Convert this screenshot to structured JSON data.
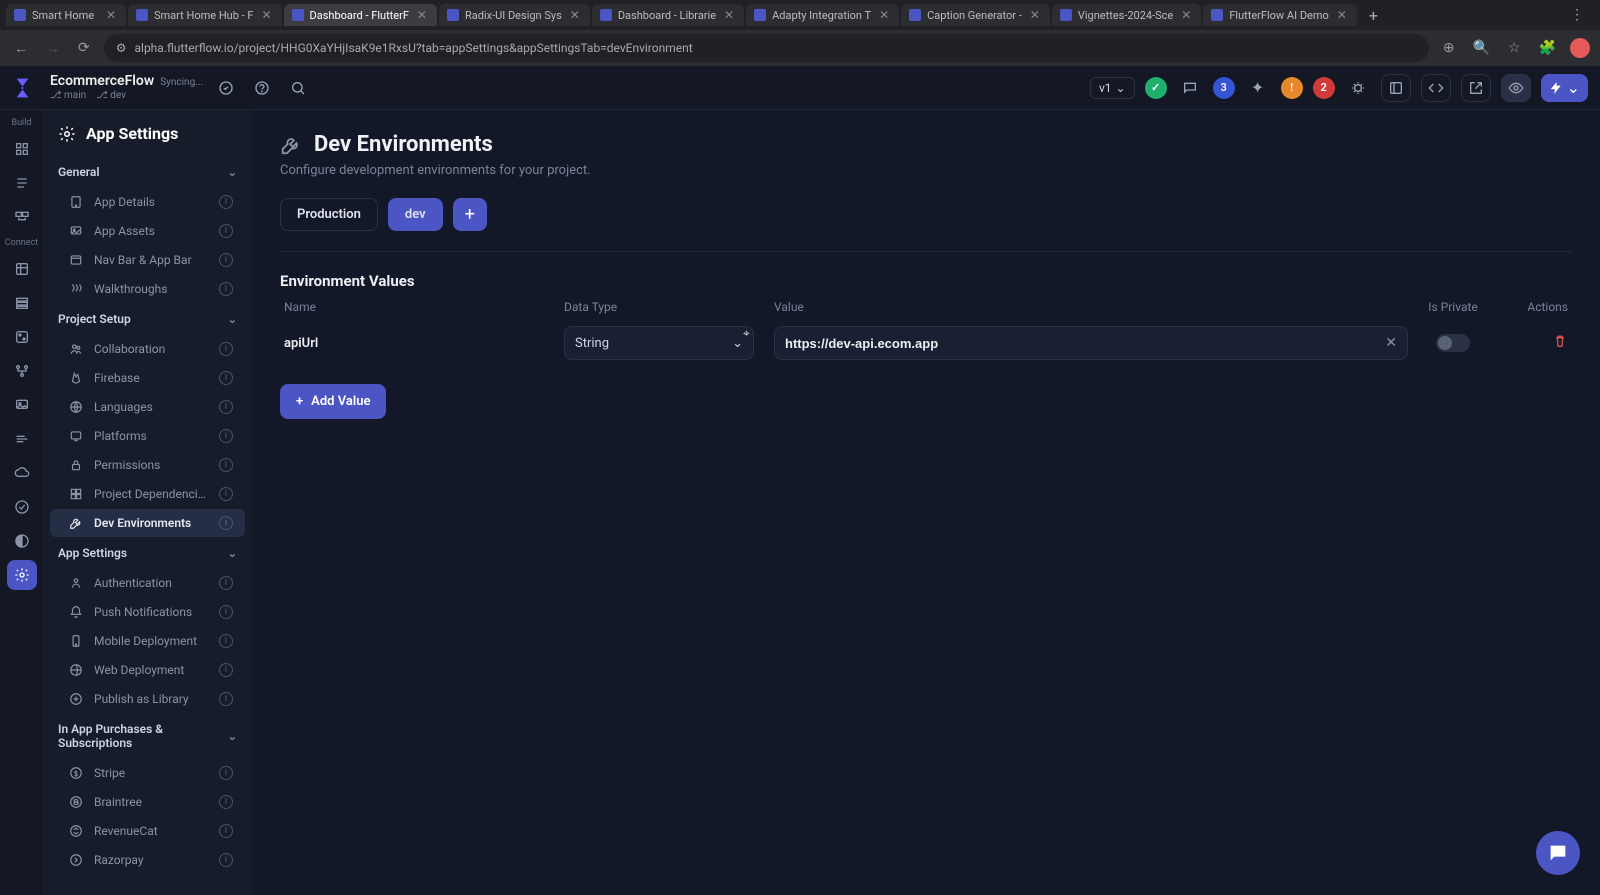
{
  "browser": {
    "tabs": [
      {
        "title": "Smart Home"
      },
      {
        "title": "Smart Home Hub - F"
      },
      {
        "title": "Dashboard - FlutterF",
        "active": true
      },
      {
        "title": "Radix-UI Design Sys"
      },
      {
        "title": "Dashboard - Librarie"
      },
      {
        "title": "Adapty Integration T"
      },
      {
        "title": "Caption Generator -"
      },
      {
        "title": "Vignettes-2024-Sce"
      },
      {
        "title": "FlutterFlow AI Demo"
      }
    ],
    "url": "alpha.flutterflow.io/project/HHG0XaYHjIsaK9e1RxsU?tab=appSettings&appSettingsTab=devEnvironment"
  },
  "topbar": {
    "project_name": "EcommerceFlow",
    "sync_label": "Syncing...",
    "branch_main_label": "main",
    "branch_dev_label": "dev",
    "version_label": "v1",
    "badge_blue": "3",
    "badge_red": "2"
  },
  "sidebar": {
    "title": "App Settings",
    "groups": [
      {
        "label": "General",
        "items": [
          {
            "icon": "app",
            "label": "App Details"
          },
          {
            "icon": "assets",
            "label": "App Assets"
          },
          {
            "icon": "navbar",
            "label": "Nav Bar & App Bar"
          },
          {
            "icon": "walk",
            "label": "Walkthroughs"
          }
        ]
      },
      {
        "label": "Project Setup",
        "items": [
          {
            "icon": "collab",
            "label": "Collaboration"
          },
          {
            "icon": "firebase",
            "label": "Firebase"
          },
          {
            "icon": "lang",
            "label": "Languages"
          },
          {
            "icon": "platform",
            "label": "Platforms"
          },
          {
            "icon": "lock",
            "label": "Permissions"
          },
          {
            "icon": "deps",
            "label": "Project Dependencies"
          },
          {
            "icon": "wrench",
            "label": "Dev Environments",
            "active": true
          }
        ]
      },
      {
        "label": "App Settings",
        "items": [
          {
            "icon": "auth",
            "label": "Authentication"
          },
          {
            "icon": "push",
            "label": "Push Notifications"
          },
          {
            "icon": "mobile",
            "label": "Mobile Deployment"
          },
          {
            "icon": "web",
            "label": "Web Deployment"
          },
          {
            "icon": "lib",
            "label": "Publish as Library"
          }
        ]
      },
      {
        "label": "In App Purchases & Subscriptions",
        "items": [
          {
            "icon": "stripe",
            "label": "Stripe"
          },
          {
            "icon": "braintree",
            "label": "Braintree"
          },
          {
            "icon": "revcat",
            "label": "RevenueCat"
          },
          {
            "icon": "razor",
            "label": "Razorpay"
          }
        ]
      }
    ]
  },
  "main": {
    "title": "Dev Environments",
    "subtitle": "Configure development environments for your project.",
    "env_tabs": {
      "prod": "Production",
      "dev": "dev"
    },
    "values_title": "Environment Values",
    "columns": {
      "name": "Name",
      "type": "Data Type",
      "value": "Value",
      "private": "Is Private",
      "actions": "Actions"
    },
    "rows": [
      {
        "name": "apiUrl",
        "type": "String",
        "value": "https://dev-api.ecom.app"
      }
    ],
    "add_value_label": "Add Value"
  }
}
